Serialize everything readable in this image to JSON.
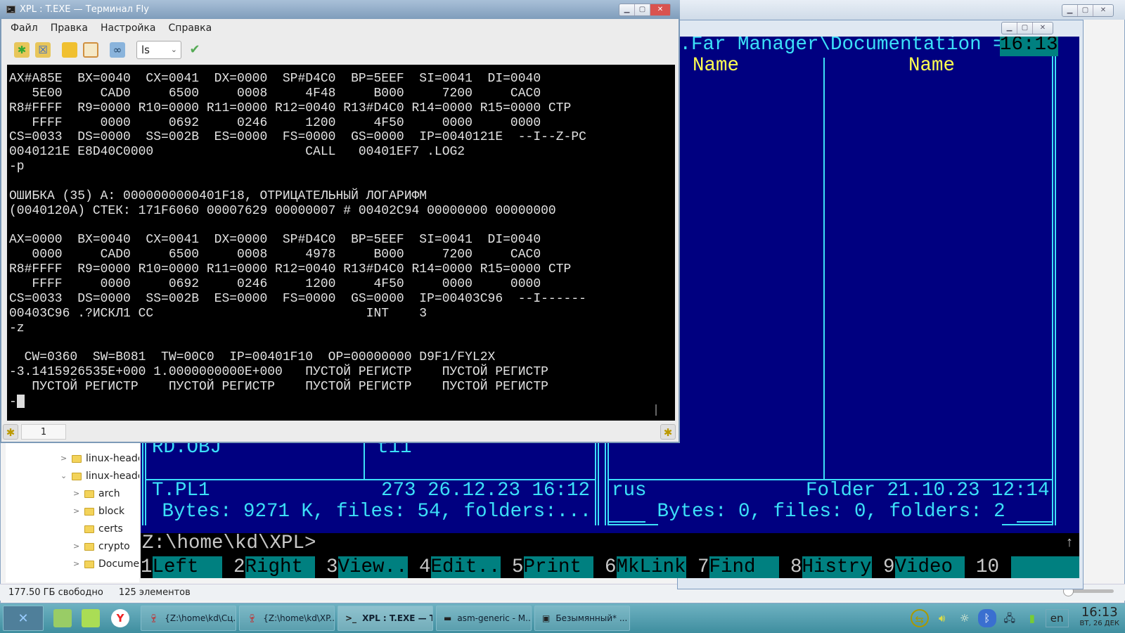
{
  "terminal": {
    "title": "XPL : T.EXE — Терминал Fly",
    "menu": [
      "Файл",
      "Правка",
      "Настройка",
      "Справка"
    ],
    "toolbar": {
      "command_combo": "ls",
      "icons": [
        "new-tab-icon",
        "close-tab-icon",
        "copy-icon",
        "paste-icon",
        "binoculars-icon"
      ],
      "run_icon": "checkmark-icon"
    },
    "lines": [
      "AX#A85E  BX=0040  CX=0041  DX=0000  SP#D4C0  BP=5EEF  SI=0041  DI=0040",
      "   5E00     CAD0     6500     0008     4F48     B000     7200     CAC0",
      "R8#FFFF  R9=0000 R10=0000 R11=0000 R12=0040 R13#D4C0 R14=0000 R15=0000 CTP",
      "   FFFF     0000     0692     0246     1200     4F50     0000     0000",
      "CS=0033  DS=0000  SS=002B  ES=0000  FS=0000  GS=0000  IP=0040121E  --I--Z-PC",
      "0040121E E8D40C0000                    CALL   00401EF7 .LOG2",
      "-p",
      "",
      "ОШИБКА (35) A: 0000000000401F18, ОТРИЦАТЕЛЬНЫЙ ЛОГАРИФМ",
      "(0040120A) СТЕК: 171F6060 00007629 00000007 # 00402C94 00000000 00000000",
      "",
      "AX=0000  BX=0040  CX=0041  DX=0000  SP#D4C0  BP=5EEF  SI=0041  DI=0040",
      "   0000     CAD0     6500     0008     4978     B000     7200     CAC0",
      "R8#FFFF  R9=0000 R10=0000 R11=0000 R12=0040 R13#D4C0 R14=0000 R15=0000 CTP",
      "   FFFF     0000     0692     0246     1200     4F50     0000     0000",
      "CS=0033  DS=0000  SS=002B  ES=0000  FS=0000  GS=0000  IP=00403C96  --I------",
      "00403C96 .?ИСКЛ1 CC                            INT    3",
      "-z",
      "",
      "  CW=0360  SW=B081  TW=00C0  IP=00401F10  OP=00000000 D9F1/FYL2X",
      "-3.1415926535E+000 1.0000000000E+000   ПУСТОЙ РЕГИСТР    ПУСТОЙ РЕГИСТР",
      "   ПУСТОЙ РЕГИСТР    ПУСТОЙ РЕГИСТР    ПУСТОЙ РЕГИСТР    ПУСТОЙ РЕГИСТР"
    ],
    "prompt": "-",
    "tab_label": "1"
  },
  "far": {
    "path_title": "..Far Manager\\Documentation =",
    "clock": "16:13",
    "col_header": "Name",
    "left": {
      "file1": "RD.OBJ",
      "file2": "t11",
      "info_name": "T.PL1",
      "info_detail": "273 26.12.23 16:12",
      "summary": " Bytes: 9271 K, files: 54, folders:..."
    },
    "right": {
      "info_name": "rus",
      "info_detail": "Folder 21.10.23 12:14",
      "summary": " Bytes: 0, files: 0, folders: 2 "
    },
    "command_line": "Z:\\home\\kd\\XPL>",
    "scroll_indicator": "↑",
    "keybar": [
      {
        "n": "1",
        "l": "Left"
      },
      {
        "n": "2",
        "l": "Right"
      },
      {
        "n": "3",
        "l": "View.."
      },
      {
        "n": "4",
        "l": "Edit.."
      },
      {
        "n": "5",
        "l": "Print"
      },
      {
        "n": "6",
        "l": "MkLink"
      },
      {
        "n": "7",
        "l": "Find"
      },
      {
        "n": "8",
        "l": "Histry"
      },
      {
        "n": "9",
        "l": "Video"
      },
      {
        "n": "10",
        "l": ""
      }
    ],
    "colors": {
      "panel_bg": "#000080",
      "text": "#3ce0f8",
      "header": "#ffff50",
      "keybar": "#008080"
    }
  },
  "file_manager": {
    "tree": [
      {
        "label": "linux-heade",
        "level": 0,
        "exp": ">"
      },
      {
        "label": "linux-heade",
        "level": 0,
        "exp": "v"
      },
      {
        "label": "arch",
        "level": 1,
        "exp": ">"
      },
      {
        "label": "block",
        "level": 1,
        "exp": ">"
      },
      {
        "label": "certs",
        "level": 1,
        "exp": ""
      },
      {
        "label": "crypto",
        "level": 1,
        "exp": ">"
      },
      {
        "label": "Docume",
        "level": 1,
        "exp": ">"
      }
    ],
    "status_free": "177.50 ГБ свободно",
    "status_count": "125 элементов"
  },
  "taskbar": {
    "tasks": [
      "{Z:\\home\\kd\\Сц...",
      "{Z:\\home\\kd\\XP...",
      "XPL : T.EXE — Te...",
      "asm-generic - M...",
      "Безымянный* ..."
    ],
    "lang": "en",
    "time": "16:13",
    "date": "ВТ, 26 ДЕК"
  }
}
